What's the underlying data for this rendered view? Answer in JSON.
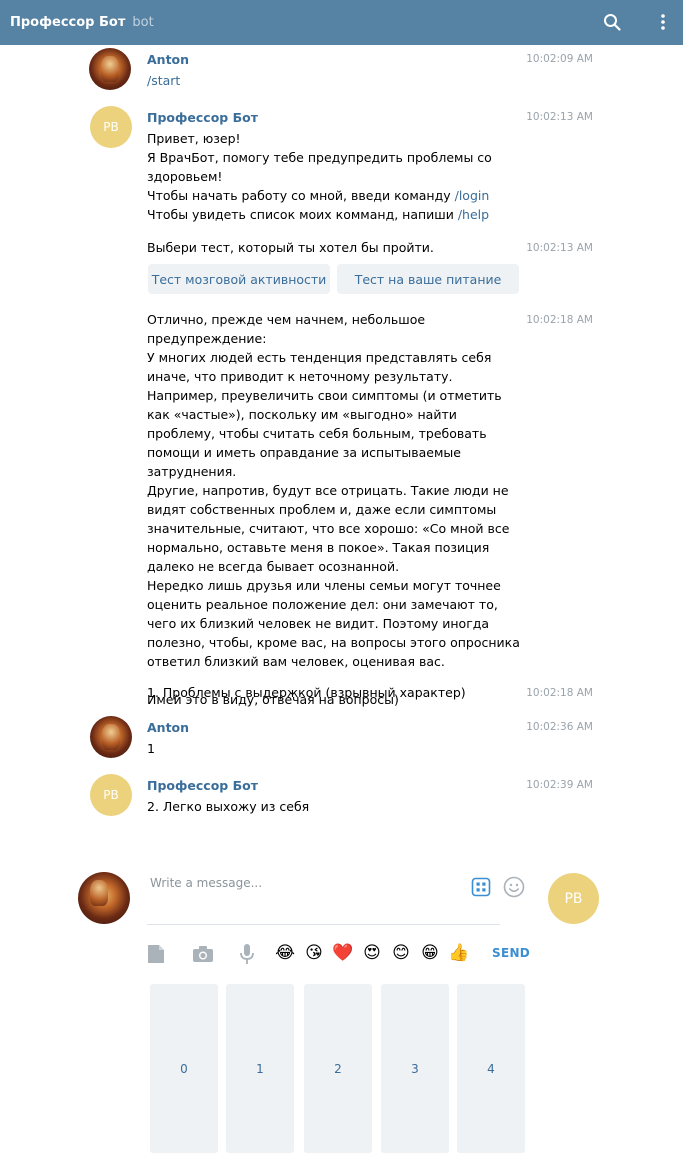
{
  "header": {
    "title": "Профессор Бот",
    "subtitle": "bot",
    "search_icon": "search-icon",
    "menu_icon": "more-vertical-icon"
  },
  "messages": [
    {
      "author": "Anton",
      "time": "10:02:09 AM",
      "text": "/start"
    },
    {
      "author": "Профессор Бот",
      "avatar_initials": "PB",
      "time": "10:02:13 AM",
      "lines": [
        "Привет, юзер!",
        "Я ВрачБот, помогу тебе предупредить проблемы со здоровьем!",
        "Чтобы начать работу со мной, введи команду ",
        "Чтобы увидеть список моих комманд, напиши "
      ],
      "login_cmd": "/login",
      "help_cmd": "/help"
    },
    {
      "time": "10:02:13 AM",
      "text": "Выбери тест, который ты хотел бы пройти.",
      "buttons": [
        "Тест мозговой активности",
        "Тест на ваше питание"
      ]
    },
    {
      "time": "10:02:18 AM",
      "text": "Отлично, прежде чем начнем, небольшое предупреждение:\nУ многих людей есть тенденция представлять себя иначе, что приводит к неточному результату. Например, преувеличить свои симптомы (и отметить как «частые»), поскольку им «выгодно» найти проблему, чтобы считать себя больным, требовать помощи и иметь оправдание за испытываемые затруднения.\nДругие, напротив, будут все отрицать. Такие люди не видят собственных проблем и, даже если симптомы значительные, считают, что все хорошо: «Со мной все нормально, оставьте меня в покое». Такая позиция далеко не всегда бывает осознанной.\nНередко лишь друзья или члены семьи могут точнее оценить реальное положение дел: они замечают то, чего их близкий человек не видит. Поэтому иногда полезно, чтобы, кроме вас, на вопросы этого опросника ответил близкий вам человек, оценивая вас.\n\nИмей это в виду, отвечая на вопросы)"
    },
    {
      "time": "10:02:18 AM",
      "text": "1. Проблемы с выдержкой (взрывный характер)"
    },
    {
      "author": "Anton",
      "time": "10:02:36 AM",
      "text": "1"
    },
    {
      "author": "Профессор Бот",
      "avatar_initials": "PB",
      "time": "10:02:39 AM",
      "text": "2. Легко выхожу из себя"
    }
  ],
  "composer": {
    "placeholder": "Write a message...",
    "send_label": "SEND",
    "bot_avatar_initials": "PB",
    "icons": [
      "bot-keyboard-icon",
      "smiley-icon",
      "file-icon",
      "camera-icon",
      "microphone-icon"
    ],
    "emojis": [
      "😂",
      "😘",
      "❤️",
      "😍",
      "😊",
      "😁",
      "👍"
    ]
  },
  "keyboard": {
    "keys": [
      "0",
      "1",
      "2",
      "3",
      "4"
    ]
  },
  "colors": {
    "header_bg": "#5682a3",
    "name": "#3a6d99",
    "avatar_bg": "#ecd27d",
    "key_bg": "#eef2f5",
    "send": "#3a8ed3"
  }
}
